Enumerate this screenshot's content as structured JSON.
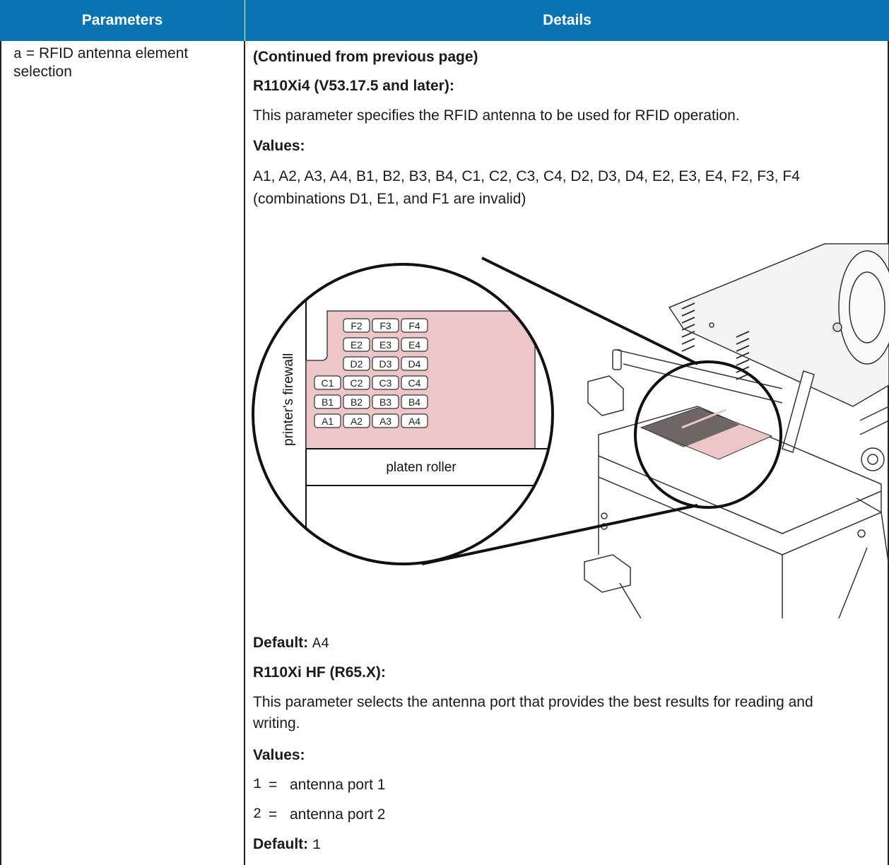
{
  "header": {
    "parameters": "Parameters",
    "details": "Details"
  },
  "parameter": {
    "code": "a",
    "description": "= RFID antenna element selection"
  },
  "details": {
    "continued": "(Continued from previous page)",
    "section1": {
      "title": "R110Xi4 (V53.17.5 and later):",
      "description": "This parameter specifies the RFID antenna to be used for RFID operation.",
      "values_label": "Values:",
      "values_text": "A1, A2, A3, A4, B1, B2, B3, B4, C1, C2, C3, C4, D2, D3, D4, E2, E3, E4, F2, F3, F4 (combinations D1, E1, and F1 are invalid)",
      "default_label": "Default:",
      "default_value": "A4"
    },
    "section2": {
      "title": "R110Xi HF (R65.X):",
      "description": "This parameter selects the antenna port that provides the best results for reading and writing.",
      "values_label": "Values:",
      "values": [
        {
          "code": "1",
          "eq": "=",
          "label": "antenna port 1"
        },
        {
          "code": "2",
          "eq": "=",
          "label": "antenna port 2"
        }
      ],
      "default_label": "Default:",
      "default_value": "1"
    }
  },
  "figure": {
    "firewall_label": "printer's firewall",
    "platen_label": "platen roller",
    "grid": [
      [
        "",
        "F2",
        "F3",
        "F4"
      ],
      [
        "",
        "E2",
        "E3",
        "E4"
      ],
      [
        "",
        "D2",
        "D3",
        "D4"
      ],
      [
        "C1",
        "C2",
        "C3",
        "C4"
      ],
      [
        "B1",
        "B2",
        "B3",
        "B4"
      ],
      [
        "A1",
        "A2",
        "A3",
        "A4"
      ]
    ],
    "colors": {
      "pink": "#ecc6c9",
      "outline": "#111111"
    }
  },
  "colors": {
    "header_bg": "#0a74b3",
    "header_text": "#ffffff"
  }
}
